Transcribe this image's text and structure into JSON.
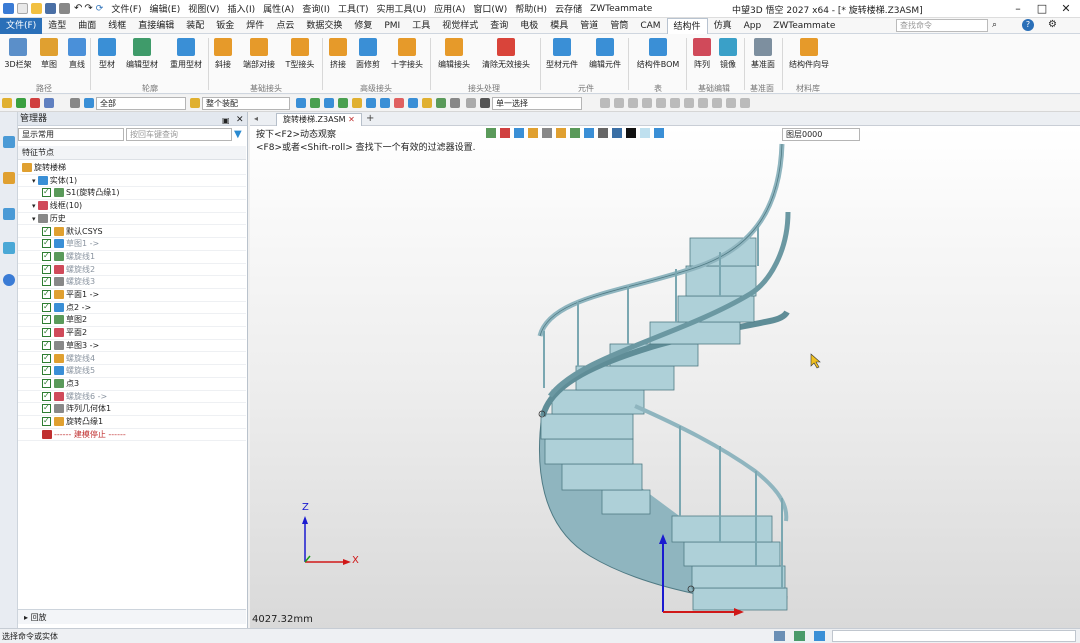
{
  "titlebar": {
    "menus": [
      "文件(F)",
      "编辑(E)",
      "视图(V)",
      "插入(I)",
      "属性(A)",
      "查询(I)",
      "工具(T)",
      "实用工具(U)",
      "应用(A)",
      "窗口(W)",
      "帮助(H)",
      "云存储",
      "ZWTeammate"
    ],
    "app_title": "中望3D 悟空 2027 x64 - [* 旋转楼梯.Z3ASM]",
    "search_placeholder": "查找命令"
  },
  "tabs": [
    "文件(F)",
    "造型",
    "曲面",
    "线框",
    "直接编辑",
    "装配",
    "钣金",
    "焊件",
    "点云",
    "数据交换",
    "修复",
    "PMI",
    "工具",
    "视觉样式",
    "查询",
    "电极",
    "模具",
    "管道",
    "管筒",
    "CAM",
    "结构件",
    "仿真",
    "App",
    "ZWTeammate"
  ],
  "active_tab": "结构件",
  "ribbon": {
    "buttons": [
      "3D栏架",
      "草图",
      "直线",
      "型材",
      "编辑型材",
      "重用型材",
      "斜接",
      "端部对接",
      "T型接头",
      "挤接",
      "面修剪",
      "十字接头",
      "编辑接头",
      "清除无效接头",
      "型材元件",
      "编辑元件",
      "结构件BOM",
      "阵列",
      "镜像",
      "基准面",
      "结构件向导"
    ],
    "groups": [
      "路径",
      "轮廓",
      "基础接头",
      "高级接头",
      "接头处理",
      "元件",
      "表",
      "基础编辑",
      "基准面",
      "材料库"
    ]
  },
  "toolbar2": {
    "filter_all": "全部",
    "assembly_scope": "整个装配",
    "select_mode": "单一选择"
  },
  "panel": {
    "title": "管理器",
    "filter": "显示常用",
    "search_placeholder": "按回车键查询",
    "column": "特征节点",
    "tree": [
      {
        "label": "旋转楼梯",
        "level": 0,
        "dim": false
      },
      {
        "label": "实体(1)",
        "level": 1,
        "dim": false
      },
      {
        "label": "S1(旋转凸缘1)",
        "level": 2,
        "dim": false
      },
      {
        "label": "线框(10)",
        "level": 1,
        "dim": false
      },
      {
        "label": "历史",
        "level": 1,
        "dim": false
      },
      {
        "label": "默认CSYS",
        "level": 2,
        "dim": false
      },
      {
        "label": "草图1 ->",
        "level": 2,
        "dim": true
      },
      {
        "label": "螺旋线1",
        "level": 2,
        "dim": true
      },
      {
        "label": "螺旋线2",
        "level": 2,
        "dim": true
      },
      {
        "label": "螺旋线3",
        "level": 2,
        "dim": true
      },
      {
        "label": "平面1 ->",
        "level": 2,
        "dim": false
      },
      {
        "label": "点2 ->",
        "level": 2,
        "dim": false
      },
      {
        "label": "草图2",
        "level": 2,
        "dim": false
      },
      {
        "label": "平面2",
        "level": 2,
        "dim": false
      },
      {
        "label": "草图3 ->",
        "level": 2,
        "dim": false
      },
      {
        "label": "螺旋线4",
        "level": 2,
        "dim": true
      },
      {
        "label": "螺旋线5",
        "level": 2,
        "dim": true
      },
      {
        "label": "点3",
        "level": 2,
        "dim": false
      },
      {
        "label": "螺旋线6 ->",
        "level": 2,
        "dim": true
      },
      {
        "label": "阵列几何体1",
        "level": 2,
        "dim": false
      },
      {
        "label": "旋转凸缘1",
        "level": 2,
        "dim": false
      },
      {
        "label": "------ 建模停止 ------",
        "level": 2,
        "dim": false,
        "stop": true
      }
    ],
    "footer": "回放"
  },
  "doc_tab": "旋转楼梯.Z3ASM",
  "viewport": {
    "hint1": "按下<F2>动态观察",
    "hint2": "<F8>或者<Shift-roll> 查找下一个有效的过滤器设置.",
    "layer": "图层0000",
    "axis_x": "X",
    "axis_z": "Z",
    "measurement": "4027.32mm"
  },
  "status": {
    "text": "选择命令或实体"
  },
  "colors": {
    "accent": "#2a6fb8",
    "stair": "#9cc3cc",
    "stair_dark": "#5f8d97",
    "axis_x": "#d01818",
    "axis_y": "#1a9a1a",
    "axis_z": "#1a1ad0"
  }
}
